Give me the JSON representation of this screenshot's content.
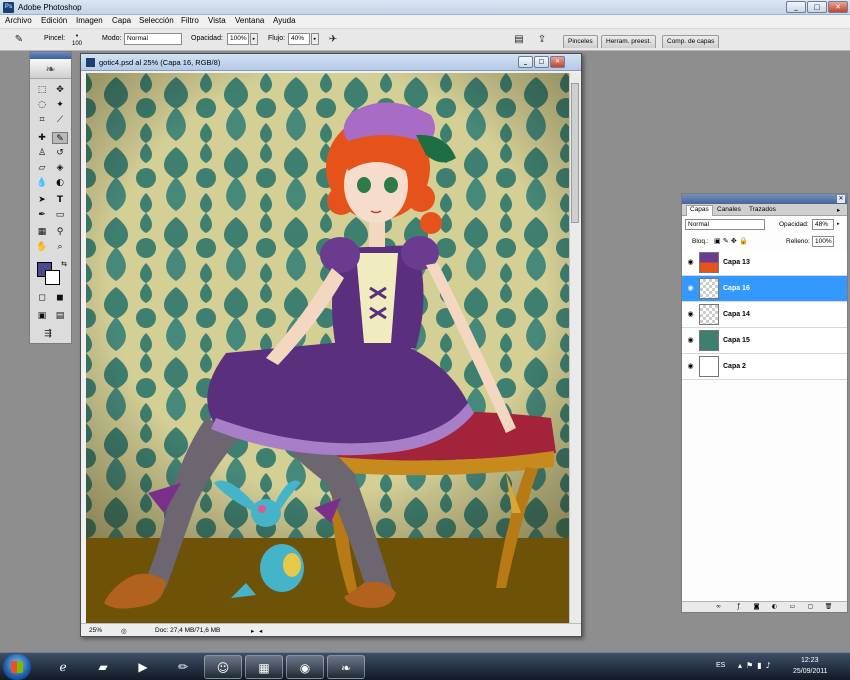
{
  "app": {
    "title": "Adobe Photoshop",
    "logo_text": "Ps",
    "window_buttons": {
      "minimize": "_",
      "maximize": "□",
      "close": "✕"
    }
  },
  "menu": [
    "Archivo",
    "Edición",
    "Imagen",
    "Capa",
    "Selección",
    "Filtro",
    "Vista",
    "Ventana",
    "Ayuda"
  ],
  "options_bar": {
    "brush_label": "Pincel:",
    "brush_size": "100",
    "mode_label": "Modo:",
    "mode_value": "Normal",
    "opacity_label": "Opacidad:",
    "opacity_value": "100%",
    "flow_label": "Flujo:",
    "flow_value": "40%",
    "panel_tabs": [
      "Pinceles",
      "Herram. preest.",
      "Comp. de capas"
    ],
    "icons": [
      "brush-tool-icon",
      "airbrush-icon",
      "palette-well-icon",
      "bridge-icon"
    ]
  },
  "tools": {
    "icons": [
      "marquee-icon",
      "move-icon",
      "lasso-icon",
      "magic-wand-icon",
      "crop-icon",
      "slice-icon",
      "healing-icon",
      "brush-icon",
      "clone-stamp-icon",
      "history-brush-icon",
      "eraser-icon",
      "paint-bucket-icon",
      "blur-icon",
      "dodge-icon",
      "path-select-icon",
      "type-icon",
      "pen-icon",
      "shape-icon",
      "notes-icon",
      "eyedropper-icon",
      "hand-icon",
      "zoom-icon"
    ],
    "foreground_color": "#4a4a8e",
    "background_color": "#ffffff"
  },
  "document": {
    "title": "gotic4.psd al 25% (Capa 16, RGB/8)",
    "zoom": "25%",
    "doc_info": "Doc: 27,4 MB/71,6 MB"
  },
  "layers_panel": {
    "tabs": [
      "Capas",
      "Canales",
      "Trazados"
    ],
    "active_tab": "Capas",
    "blend_mode": "Normal",
    "opacity_label": "Opacidad:",
    "opacity_value": "48%",
    "lock_label": "Bloq.:",
    "fill_label": "Relleno:",
    "fill_value": "100%",
    "layers": [
      {
        "name": "Capa 13",
        "selected": false,
        "thumb": "character"
      },
      {
        "name": "Capa 16",
        "selected": true,
        "thumb": "transparent"
      },
      {
        "name": "Capa 14",
        "selected": false,
        "thumb": "transparent"
      },
      {
        "name": "Capa 15",
        "selected": false,
        "thumb": "pattern"
      },
      {
        "name": "Capa 2",
        "selected": false,
        "thumb": "white"
      }
    ]
  },
  "taskbar": {
    "apps": [
      "internet-explorer-icon",
      "explorer-folder-icon",
      "media-player-icon",
      "paint-icon",
      "messenger-icon",
      "clapper-icon",
      "chrome-icon",
      "photoshop-feather-icon"
    ],
    "language": "ES",
    "time": "12:23",
    "date": "25/09/2011"
  },
  "colors": {
    "selection": "#3399ff",
    "wallpaper_green": "#3f7f6f",
    "wallpaper_cream": "#d8d49a",
    "floor": "#6e5208",
    "dress_purple": "#5a2f7e",
    "hair_orange": "#e5531a"
  }
}
